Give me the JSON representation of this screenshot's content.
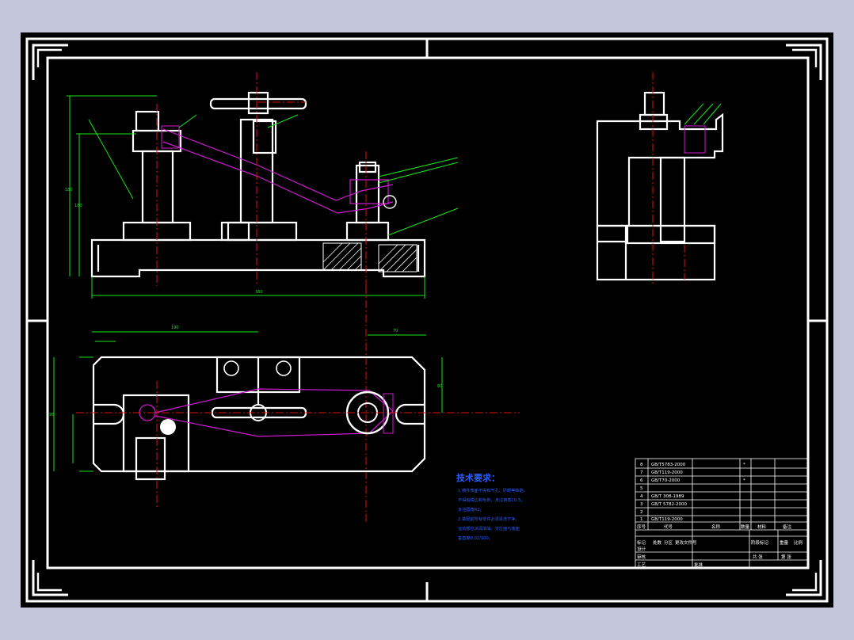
{
  "tech_requirements": {
    "title": "技术要求：",
    "lines": [
      "1.铸件表面不得有气孔、砂眼等缺陷，",
      "不得有锐边和毛刺，未注倒角C0.5，",
      "未注圆角R2。",
      "2.装配前所有零件必须清洗干净，",
      "运动部位涂润滑油，定位面与底面",
      "垂直度0.02/100。"
    ]
  },
  "bom": {
    "rows": [
      {
        "no": "8",
        "code": "GB/T5783-2000",
        "mark": "*"
      },
      {
        "no": "7",
        "code": "GB/T119-2000",
        "mark": "*"
      },
      {
        "no": "6",
        "code": "GB/T70-2000",
        "mark": "*"
      },
      {
        "no": "5",
        "code": "",
        "mark": "*"
      },
      {
        "no": "4",
        "code": "GB/T 308-1989",
        "mark": "*"
      },
      {
        "no": "3",
        "code": "GB/T 5782-2000",
        "mark": "*"
      },
      {
        "no": "2",
        "code": "",
        "mark": "*"
      },
      {
        "no": "1",
        "code": "GB/T119-2000",
        "mark": "*"
      }
    ],
    "header": [
      "序号",
      "代号",
      "名称",
      "数量",
      "材料",
      "备注"
    ]
  },
  "title_block": {
    "drawing_name": "",
    "labels": [
      "标记",
      "处数",
      "分区",
      "更改文件号",
      "设计",
      "审核",
      "工艺"
    ],
    "stage_label": "阶段标记",
    "weight_label": "重量",
    "scale_label": "比例",
    "sheet_total": "共 张",
    "sheet_no": "第 张",
    "approve_label": "批准"
  },
  "colors": {
    "sheet": "#000000",
    "frame": "#ffffff",
    "dimension": "#16e616",
    "centerline": "#e01010",
    "construction": "#d21ad2",
    "notes": "#2a5cff"
  }
}
